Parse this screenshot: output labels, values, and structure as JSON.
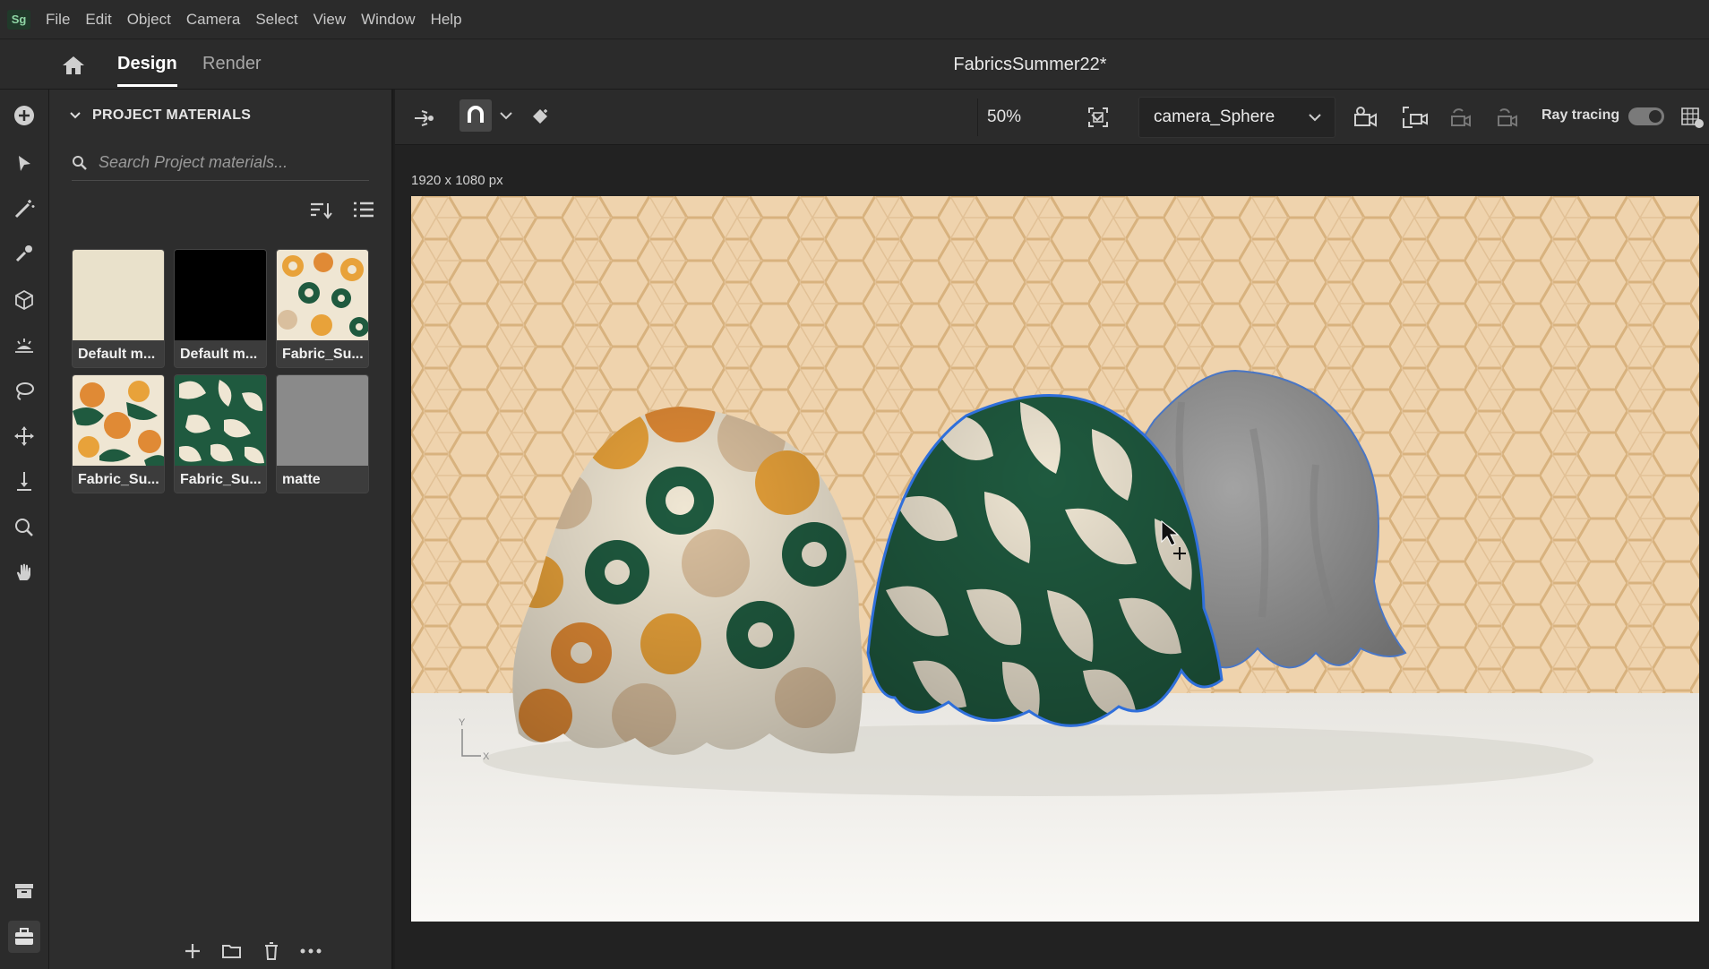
{
  "app": {
    "badge": "Sg"
  },
  "menu": [
    "File",
    "Edit",
    "Object",
    "Camera",
    "Select",
    "View",
    "Window",
    "Help"
  ],
  "tabs": {
    "design": "Design",
    "render": "Render"
  },
  "document_title": "FabricsSummer22*",
  "panel": {
    "title": "PROJECT MATERIALS",
    "search_placeholder": "Search Project materials...",
    "materials": [
      {
        "label": "Default m...",
        "color": "#e9e1cb"
      },
      {
        "label": "Default m...",
        "color": "#000000"
      },
      {
        "label": "Fabric_Su...",
        "color": "#e8a23a"
      },
      {
        "label": "Fabric_Su...",
        "color": "#e08a35"
      },
      {
        "label": "Fabric_Su...",
        "color": "#1f5a3f"
      },
      {
        "label": "matte",
        "color": "#8a8a8a"
      }
    ]
  },
  "viewport_toolbar": {
    "zoom": "50%",
    "camera": "camera_Sphere",
    "ray_tracing_label": "Ray tracing",
    "ray_tracing_on": true
  },
  "viewport": {
    "dimensions": "1920 x 1080 px",
    "axis_y": "Y",
    "axis_x": "X"
  },
  "colors": {
    "accent_selection": "#2f6fdb",
    "wall": "#efd3ad",
    "floor": "#f1efe9",
    "fabric_green": "#1f5a3f",
    "fabric_orange": "#e08a35",
    "fabric_cream": "#efe6d3",
    "fabric_gray": "#8d8d8d"
  }
}
